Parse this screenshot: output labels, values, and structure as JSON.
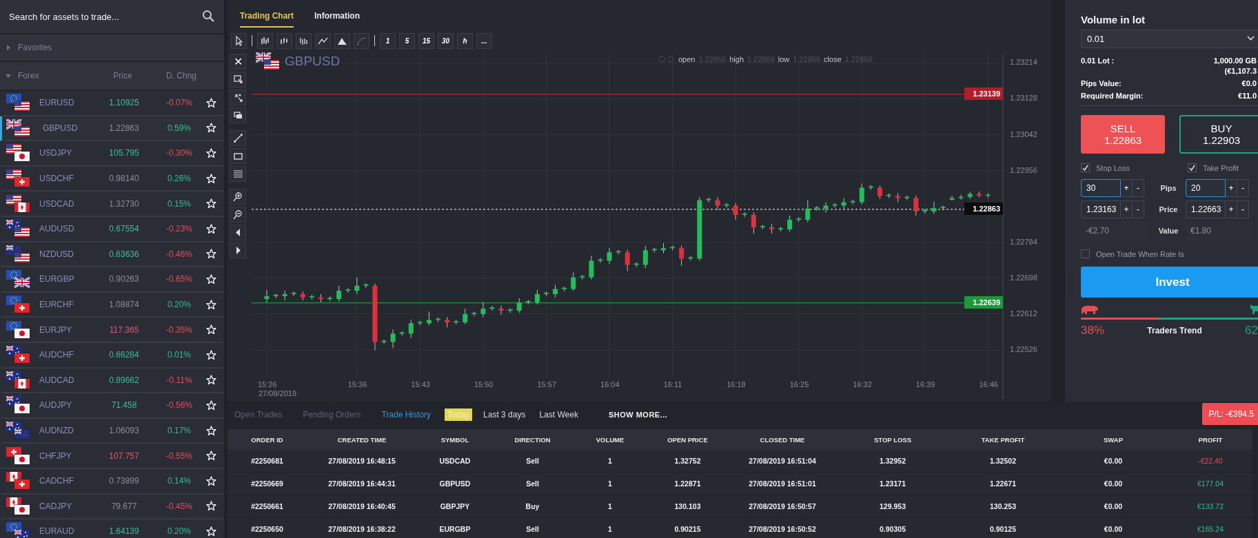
{
  "search": {
    "placeholder": "Search for assets to trade..."
  },
  "favorites": {
    "label": "Favorites",
    "expanded": false
  },
  "forex": {
    "label": "Forex",
    "expanded": true,
    "columns": [
      "Price",
      "D. Chng"
    ],
    "assets": [
      {
        "symbol": "EURUSD",
        "flags": [
          {
            "kind": "eu"
          },
          {
            "kind": "us"
          }
        ],
        "price": {
          "value": "1.10925",
          "color": "#3cbf95"
        },
        "change": {
          "value": "-0.07%",
          "color": "#ec4a5c"
        },
        "selected": false
      },
      {
        "symbol": "GBPUSD",
        "flags": [
          {
            "kind": "gb"
          },
          {
            "kind": "us"
          }
        ],
        "price": {
          "value": "1.22863",
          "color": "#8a8e9c"
        },
        "change": {
          "value": "0.59%",
          "color": "#2fc08d"
        },
        "selected": true
      },
      {
        "symbol": "USDJPY",
        "flags": [
          {
            "kind": "us"
          },
          {
            "kind": "jp"
          }
        ],
        "price": {
          "value": "105.795",
          "color": "#3cbf95"
        },
        "change": {
          "value": "-0.30%",
          "color": "#ec4a5c"
        },
        "selected": false
      },
      {
        "symbol": "USDCHF",
        "flags": [
          {
            "kind": "us"
          },
          {
            "kind": "ch"
          }
        ],
        "price": {
          "value": "0.98140",
          "color": "#8a8e9c"
        },
        "change": {
          "value": "0.26%",
          "color": "#2fc08d"
        },
        "selected": false
      },
      {
        "symbol": "USDCAD",
        "flags": [
          {
            "kind": "us"
          },
          {
            "kind": "ca"
          }
        ],
        "price": {
          "value": "1.32730",
          "color": "#8a8e9c"
        },
        "change": {
          "value": "0.15%",
          "color": "#2fc08d"
        },
        "selected": false
      },
      {
        "symbol": "AUDUSD",
        "flags": [
          {
            "kind": "au"
          },
          {
            "kind": "us"
          }
        ],
        "price": {
          "value": "0.67554",
          "color": "#3cbf95"
        },
        "change": {
          "value": "-0.23%",
          "color": "#ec4a5c"
        },
        "selected": false
      },
      {
        "symbol": "NZDUSD",
        "flags": [
          {
            "kind": "nz"
          },
          {
            "kind": "us"
          }
        ],
        "price": {
          "value": "0.63636",
          "color": "#3cbf95"
        },
        "change": {
          "value": "-0.46%",
          "color": "#ec4a5c"
        },
        "selected": false
      },
      {
        "symbol": "EURGBP",
        "flags": [
          {
            "kind": "eu"
          },
          {
            "kind": "gb"
          }
        ],
        "price": {
          "value": "0.90263",
          "color": "#8a8e9c"
        },
        "change": {
          "value": "-0.65%",
          "color": "#ec4a5c"
        },
        "selected": false
      },
      {
        "symbol": "EURCHF",
        "flags": [
          {
            "kind": "eu"
          },
          {
            "kind": "ch"
          }
        ],
        "price": {
          "value": "1.08874",
          "color": "#8a8e9c"
        },
        "change": {
          "value": "0.20%",
          "color": "#2fc08d"
        },
        "selected": false
      },
      {
        "symbol": "EURJPY",
        "flags": [
          {
            "kind": "eu"
          },
          {
            "kind": "jp"
          }
        ],
        "price": {
          "value": "117.365",
          "color": "#e8556f"
        },
        "change": {
          "value": "-0.35%",
          "color": "#ec4a5c"
        },
        "selected": false
      },
      {
        "symbol": "AUDCHF",
        "flags": [
          {
            "kind": "au"
          },
          {
            "kind": "ch"
          }
        ],
        "price": {
          "value": "0.66284",
          "color": "#3cbf95"
        },
        "change": {
          "value": "0.01%",
          "color": "#2fc08d"
        },
        "selected": false
      },
      {
        "symbol": "AUDCAD",
        "flags": [
          {
            "kind": "au"
          },
          {
            "kind": "ca"
          }
        ],
        "price": {
          "value": "0.89662",
          "color": "#3cbf95"
        },
        "change": {
          "value": "-0.11%",
          "color": "#ec4a5c"
        },
        "selected": false
      },
      {
        "symbol": "AUDJPY",
        "flags": [
          {
            "kind": "au"
          },
          {
            "kind": "jp"
          }
        ],
        "price": {
          "value": "71.458",
          "color": "#3cbf95"
        },
        "change": {
          "value": "-0.56%",
          "color": "#ec4a5c"
        },
        "selected": false
      },
      {
        "symbol": "AUDNZD",
        "flags": [
          {
            "kind": "au"
          },
          {
            "kind": "nz"
          }
        ],
        "price": {
          "value": "1.06093",
          "color": "#8a8e9c"
        },
        "change": {
          "value": "0.17%",
          "color": "#2fc08d"
        },
        "selected": false
      },
      {
        "symbol": "CHFJPY",
        "flags": [
          {
            "kind": "ch"
          },
          {
            "kind": "jp"
          }
        ],
        "price": {
          "value": "107.757",
          "color": "#e8556f"
        },
        "change": {
          "value": "-0.55%",
          "color": "#ec4a5c"
        },
        "selected": false
      },
      {
        "symbol": "CADCHF",
        "flags": [
          {
            "kind": "ca"
          },
          {
            "kind": "ch"
          }
        ],
        "price": {
          "value": "0.73899",
          "color": "#8a8e9c"
        },
        "change": {
          "value": "0.14%",
          "color": "#2fc08d"
        },
        "selected": false
      },
      {
        "symbol": "CADJPY",
        "flags": [
          {
            "kind": "ca"
          },
          {
            "kind": "jp"
          }
        ],
        "price": {
          "value": "79.677",
          "color": "#8a8e9c"
        },
        "change": {
          "value": "-0.45%",
          "color": "#ec4a5c"
        },
        "selected": false
      },
      {
        "symbol": "EURAUD",
        "flags": [
          {
            "kind": "eu"
          },
          {
            "kind": "au"
          }
        ],
        "price": {
          "value": "1.64139",
          "color": "#3cbf95"
        },
        "change": {
          "value": "0.20%",
          "color": "#2fc08d"
        },
        "selected": false
      }
    ]
  },
  "chart": {
    "tabs": [
      {
        "label": "Trading Chart",
        "selected": true
      },
      {
        "label": "Information",
        "selected": false
      }
    ],
    "timeframes": [
      "1",
      "5",
      "15",
      "30",
      "h",
      "..."
    ],
    "close_tool": "✕",
    "symbol": "GBPUSD",
    "flags": [
      {
        "kind": "gb"
      },
      {
        "kind": "us"
      }
    ],
    "legend": [
      {
        "label": "open",
        "value": "1.22866"
      },
      {
        "label": "high",
        "value": "1.22866"
      },
      {
        "label": "low",
        "value": "1.22866"
      },
      {
        "label": "close",
        "value": "1.22866"
      }
    ],
    "date": "27/08/2019",
    "chart_data": {
      "type": "candlestick",
      "categories": [
        "15:26",
        null,
        null,
        null,
        null,
        null,
        null,
        null,
        null,
        null,
        "15:36",
        null,
        null,
        null,
        null,
        null,
        null,
        "15:43",
        null,
        null,
        null,
        null,
        null,
        null,
        "15:50",
        null,
        null,
        null,
        null,
        null,
        null,
        "15:57",
        null,
        null,
        null,
        null,
        null,
        null,
        "16:04",
        null,
        null,
        null,
        null,
        null,
        null,
        "16:11",
        null,
        null,
        null,
        null,
        null,
        null,
        "16:18",
        null,
        null,
        null,
        null,
        null,
        null,
        "16:25",
        null,
        null,
        null,
        null,
        null,
        null,
        "16:32",
        null,
        null,
        null,
        null,
        null,
        null,
        "16:39",
        null,
        null,
        null,
        null,
        null,
        null,
        "16:46"
      ],
      "ohlc": [
        [
          1.22648,
          1.2267,
          1.2264,
          1.22655
        ],
        [
          1.22655,
          1.22661,
          1.2265,
          1.22658
        ],
        [
          1.22655,
          1.22668,
          1.22645,
          1.2266
        ],
        [
          1.2266,
          1.22666,
          1.22655,
          1.22663
        ],
        [
          1.2266,
          1.22666,
          1.22645,
          1.22652
        ],
        [
          1.22652,
          1.22658,
          1.22647,
          1.22655
        ],
        [
          1.22652,
          1.2266,
          1.2264,
          1.22648
        ],
        [
          1.22648,
          1.22654,
          1.22643,
          1.22651
        ],
        [
          1.22648,
          1.2268,
          1.22642,
          1.22668
        ],
        [
          1.22668,
          1.22674,
          1.22663,
          1.22671
        ],
        [
          1.22668,
          1.227,
          1.2266,
          1.2268
        ],
        [
          1.2268,
          1.22686,
          1.22675,
          1.22683
        ],
        [
          1.2268,
          1.22685,
          1.22525,
          1.22545
        ],
        [
          1.22545,
          1.22551,
          1.2254,
          1.22548
        ],
        [
          1.22545,
          1.22575,
          1.2253,
          1.22565
        ],
        [
          1.22565,
          1.22571,
          1.2256,
          1.22568
        ],
        [
          1.22565,
          1.22598,
          1.22555,
          1.2259
        ],
        [
          1.2259,
          1.22596,
          1.22585,
          1.22593
        ],
        [
          1.2259,
          1.22618,
          1.22585,
          1.22598
        ],
        [
          1.22598,
          1.22604,
          1.22593,
          1.22601
        ],
        [
          1.22598,
          1.22605,
          1.2258,
          1.22592
        ],
        [
          1.22592,
          1.22598,
          1.22587,
          1.22595
        ],
        [
          1.22592,
          1.22625,
          1.22588,
          1.22612
        ],
        [
          1.22612,
          1.22618,
          1.22607,
          1.22615
        ],
        [
          1.22612,
          1.2264,
          1.22605,
          1.22625
        ],
        [
          1.22625,
          1.22631,
          1.2262,
          1.22628
        ],
        [
          1.22625,
          1.22632,
          1.2261,
          1.2262
        ],
        [
          1.2262,
          1.22626,
          1.22615,
          1.22623
        ],
        [
          1.2262,
          1.2265,
          1.22615,
          1.2264
        ],
        [
          1.2264,
          1.22646,
          1.22635,
          1.22643
        ],
        [
          1.2264,
          1.2267,
          1.22635,
          1.2266
        ],
        [
          1.2266,
          1.22666,
          1.22655,
          1.22663
        ],
        [
          1.2266,
          1.22682,
          1.22652,
          1.22672
        ],
        [
          1.22672,
          1.22678,
          1.22667,
          1.22675
        ],
        [
          1.22672,
          1.22712,
          1.22668,
          1.227
        ],
        [
          1.227,
          1.22706,
          1.22695,
          1.22703
        ],
        [
          1.227,
          1.22752,
          1.22695,
          1.2274
        ],
        [
          1.2274,
          1.22746,
          1.22735,
          1.22743
        ],
        [
          1.2274,
          1.2277,
          1.22732,
          1.2276
        ],
        [
          1.2276,
          1.22766,
          1.22755,
          1.22763
        ],
        [
          1.2276,
          1.22766,
          1.22715,
          1.2273
        ],
        [
          1.2273,
          1.22736,
          1.22725,
          1.22733
        ],
        [
          1.2273,
          1.22775,
          1.22722,
          1.22765
        ],
        [
          1.22765,
          1.22771,
          1.2276,
          1.22768
        ],
        [
          1.22765,
          1.22782,
          1.22758,
          1.2277
        ],
        [
          1.2277,
          1.22776,
          1.22765,
          1.22773
        ],
        [
          1.2277,
          1.22776,
          1.22728,
          1.22745
        ],
        [
          1.22745,
          1.22751,
          1.2274,
          1.22748
        ],
        [
          1.22745,
          1.22892,
          1.2274,
          1.22885
        ],
        [
          1.22885,
          1.22891,
          1.2288,
          1.22888
        ],
        [
          1.22885,
          1.22892,
          1.22862,
          1.22872
        ],
        [
          1.22872,
          1.22878,
          1.22867,
          1.22875
        ],
        [
          1.22872,
          1.22878,
          1.22838,
          1.2285
        ],
        [
          1.2285,
          1.22856,
          1.22845,
          1.22853
        ],
        [
          1.2285,
          1.22856,
          1.22805,
          1.2282
        ],
        [
          1.2282,
          1.22826,
          1.22815,
          1.22823
        ],
        [
          1.2282,
          1.22828,
          1.22805,
          1.22815
        ],
        [
          1.22815,
          1.22821,
          1.2281,
          1.22818
        ],
        [
          1.22815,
          1.22848,
          1.2281,
          1.22838
        ],
        [
          1.22838,
          1.22844,
          1.22833,
          1.22841
        ],
        [
          1.22838,
          1.22885,
          1.22832,
          1.22865
        ],
        [
          1.22865,
          1.22871,
          1.2286,
          1.22868
        ],
        [
          1.22865,
          1.2288,
          1.22855,
          1.22872
        ],
        [
          1.22872,
          1.22878,
          1.22867,
          1.22875
        ],
        [
          1.22872,
          1.2289,
          1.22865,
          1.2288
        ],
        [
          1.2288,
          1.22886,
          1.22875,
          1.22883
        ],
        [
          1.2288,
          1.22925,
          1.22875,
          1.22915
        ],
        [
          1.22915,
          1.22921,
          1.2291,
          1.22918
        ],
        [
          1.22915,
          1.2292,
          1.22888,
          1.22895
        ],
        [
          1.22895,
          1.22901,
          1.2289,
          1.22898
        ],
        [
          1.22895,
          1.22902,
          1.2288,
          1.2289
        ],
        [
          1.2289,
          1.22896,
          1.22885,
          1.22893
        ],
        [
          1.2289,
          1.22896,
          1.22848,
          1.22858
        ],
        [
          1.22858,
          1.22864,
          1.22853,
          1.22861
        ],
        [
          1.22858,
          1.22882,
          1.22852,
          1.22866
        ],
        [
          1.22866,
          1.22872,
          1.22861,
          1.22869
        ],
        [
          1.22886,
          1.22896,
          1.22884,
          1.2289
        ],
        [
          1.2289,
          1.22898,
          1.22886,
          1.22893
        ],
        [
          1.22893,
          1.22905,
          1.22888,
          1.229
        ],
        [
          1.229,
          1.22906,
          1.22892,
          1.22896
        ],
        [
          1.22896,
          1.22902,
          1.2289,
          1.22898
        ]
      ],
      "ylim": [
        1.2246,
        1.23236
      ],
      "grid": true,
      "ref_lines": [
        {
          "axis": "y",
          "value": 1.23139,
          "label": "1.23139",
          "color": "#b01e2c"
        },
        {
          "axis": "y",
          "value": 1.22863,
          "label": "1.22863",
          "color": "#cfcfcf"
        },
        {
          "axis": "y",
          "value": 1.22639,
          "label": "1.22639",
          "color": "#1b9a3a"
        }
      ],
      "yticks": [
        1.23214,
        1.23128,
        1.23042,
        1.22956,
        1.22784,
        1.22698,
        1.22612,
        1.22526
      ]
    }
  },
  "order": {
    "volume_label": "Volume in lot",
    "volume": "0.01",
    "lot_label": "0.01 Lot :",
    "lot_value": "1,000.00 GB",
    "lot_value_eur": "(€1,107.3",
    "pips_value_label": "Pips Value:",
    "pips_value": "€0.0",
    "margin_label": "Required Margin:",
    "margin": "€11.0",
    "sides": [
      {
        "kind": "sell",
        "label": "SELL",
        "price": "1.22863",
        "selected": true
      },
      {
        "kind": "buy",
        "label": "BUY",
        "price": "1.22903",
        "selected": false
      }
    ],
    "limits": [
      {
        "label": "Stop Loss",
        "checked": true,
        "pips": "30",
        "price": "1.23163",
        "value": "-€2.70"
      },
      {
        "label": "Take Profit",
        "checked": true,
        "pips": "20",
        "price": "1.22663",
        "value": "€1.80"
      }
    ],
    "stepper": [
      "+",
      "-"
    ],
    "row_labels": [
      "Pips",
      "Price",
      "Value"
    ],
    "open_when_rate": {
      "label": "Open Trade When Rate Is",
      "checked": false
    },
    "invest": "Invest",
    "trend": {
      "label": "Traders Trend",
      "sell_percent": "38%",
      "buy_percent": "62",
      "level": 0.38
    }
  },
  "history": {
    "tabs": [
      {
        "label": "Open Trades",
        "selected": false
      },
      {
        "label": "Pending Orders",
        "selected": false
      },
      {
        "label": "Trade History",
        "selected": true
      }
    ],
    "periods": [
      {
        "label": "Today",
        "selected": true
      },
      {
        "label": "Last 3 days",
        "selected": false
      },
      {
        "label": "Last Week",
        "selected": false
      }
    ],
    "show_more": "SHOW MORE...",
    "pl": "P/L: -€394.5",
    "columns": [
      "ORDER ID",
      "CREATED TIME",
      "SYMBOL",
      "DIRECTION",
      "VOLUME",
      "OPEN PRICE",
      "CLOSED TIME",
      "STOP LOSS",
      "TAKE PROFIT",
      "SWAP",
      "PROFIT"
    ],
    "rows": [
      {
        "cells": [
          "#2250681",
          "27/08/2019 16:48:15",
          "USDCAD",
          "Sell",
          "1",
          "1.32752",
          "27/08/2019 16:51:04",
          "1.32952",
          "1.32502",
          "€0.00",
          "-€22.40"
        ],
        "color": "#ec4a5c"
      },
      {
        "cells": [
          "#2250669",
          "27/08/2019 16:44:31",
          "GBPUSD",
          "Sell",
          "1",
          "1.22871",
          "27/08/2019 16:51:01",
          "1.23171",
          "1.22671",
          "€0.00",
          "€177.04"
        ],
        "color": "#2fc08d"
      },
      {
        "cells": [
          "#2250661",
          "27/08/2019 16:40:45",
          "GBPJPY",
          "Buy",
          "1",
          "130.103",
          "27/08/2019 16:50:57",
          "129.953",
          "130.253",
          "€0.00",
          "€133.72"
        ],
        "color": "#2fc08d"
      },
      {
        "cells": [
          "#2250650",
          "27/08/2019 16:38:22",
          "EURGBP",
          "Sell",
          "1",
          "0.90215",
          "27/08/2019 16:50:52",
          "0.90305",
          "0.90125",
          "€0.00",
          "€165.24"
        ],
        "color": "#2fc08d"
      }
    ]
  }
}
